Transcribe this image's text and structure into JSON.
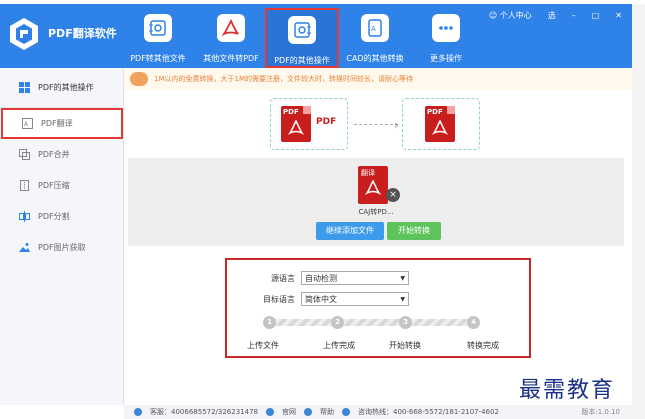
{
  "app": {
    "title": "PDF翻译软件"
  },
  "toolbar": {
    "items": [
      {
        "label": "PDF转其他文件",
        "icon": "convert-icon"
      },
      {
        "label": "其他文件转PDF",
        "icon": "pdf-icon"
      },
      {
        "label": "PDF的其他操作",
        "icon": "settings-doc-icon",
        "active": true
      },
      {
        "label": "CAD的其他转换",
        "icon": "cad-icon"
      },
      {
        "label": "更多操作",
        "icon": "more-icon"
      }
    ]
  },
  "window": {
    "user_center": "个人中心",
    "skin": "选",
    "minimize": "–",
    "maximize": "□",
    "close": "✕"
  },
  "sidebar": {
    "header": "PDF的其他操作",
    "items": [
      {
        "label": "PDF翻译",
        "active": true
      },
      {
        "label": "PDF合并"
      },
      {
        "label": "PDF压缩"
      },
      {
        "label": "PDF分割"
      },
      {
        "label": "PDF图片获取"
      }
    ]
  },
  "notice": {
    "text": "1M以内的免费转换，大于1M的需要注册，文件较大时，转换时间较长，请耐心等待"
  },
  "conversion": {
    "target_label": "PDF",
    "arrow": "›"
  },
  "file": {
    "badge": "翻译",
    "name": "CAJ转PD...",
    "close": "×"
  },
  "buttons": {
    "add_more": "继续添加文件",
    "start": "开始转换"
  },
  "settings": {
    "source_label": "源语言",
    "source_value": "自动检测",
    "target_label": "目标语言",
    "target_value": "简体中文"
  },
  "steps": [
    {
      "num": "1",
      "label": "上传文件"
    },
    {
      "num": "2",
      "label": "上传完成"
    },
    {
      "num": "3",
      "label": "开始转换"
    },
    {
      "num": "4",
      "label": "转换完成"
    }
  ],
  "footer": {
    "qq": "客服：4006685572/326231478",
    "website": "官网",
    "help": "帮助",
    "hotline": "咨询热线：400-668-5572/181-2107-4602",
    "version": "版本:1.0.10"
  },
  "watermark": "最需教育",
  "colors": {
    "header": "#2f82e8",
    "highlight": "#e53935",
    "pdf_red": "#c81e1e",
    "button_blue": "#3d9be9",
    "button_green": "#5fc35c"
  }
}
